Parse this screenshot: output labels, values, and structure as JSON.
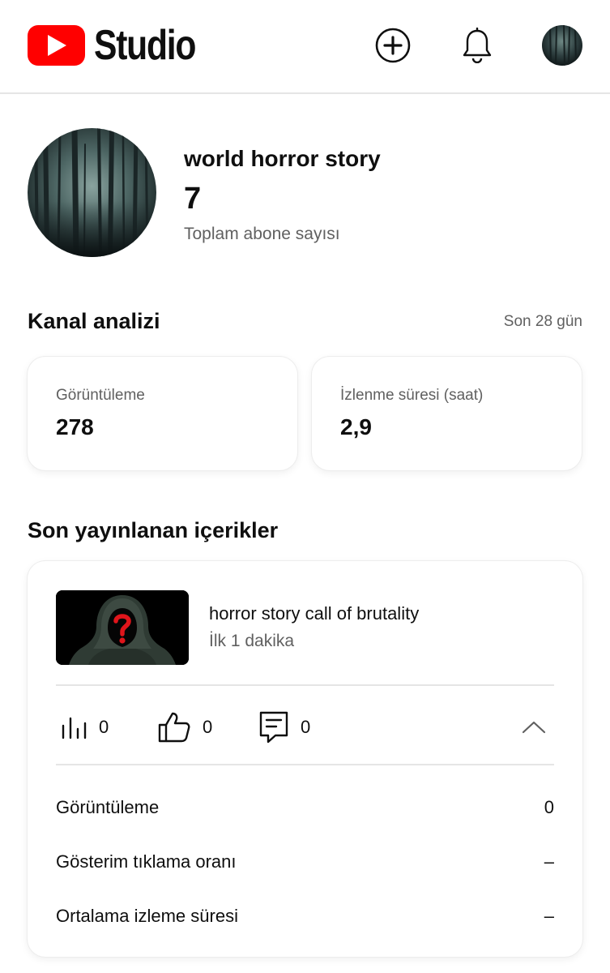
{
  "header": {
    "logo_text": "Studio",
    "icons": {
      "logo": "youtube-play-icon",
      "create": "plus-circle-icon",
      "notifications": "bell-icon",
      "account": "avatar"
    },
    "brand_color": "#ff0000"
  },
  "channel": {
    "name": "world horror story",
    "subscribers": "7",
    "subscribers_label": "Toplam abone sayısı"
  },
  "analytics": {
    "title": "Kanal analizi",
    "range": "Son 28 gün",
    "cards": [
      {
        "label": "Görüntüleme",
        "value": "278"
      },
      {
        "label": "İzlenme süresi (saat)",
        "value": "2,9"
      }
    ]
  },
  "recent": {
    "title": "Son yayınlanan içerikler",
    "video": {
      "title": "horror story call of brutality",
      "subtitle": "İlk 1 dakika",
      "thumbnail": "hooded-figure-question-mark"
    },
    "metrics": [
      {
        "icon": "bar-chart-icon",
        "value": "0"
      },
      {
        "icon": "thumbs-up-icon",
        "value": "0"
      },
      {
        "icon": "comment-icon",
        "value": "0"
      }
    ],
    "details": [
      {
        "label": "Görüntüleme",
        "value": "0"
      },
      {
        "label": "Gösterim tıklama oranı",
        "value": "–"
      },
      {
        "label": "Ortalama izleme süresi",
        "value": "–"
      }
    ]
  }
}
